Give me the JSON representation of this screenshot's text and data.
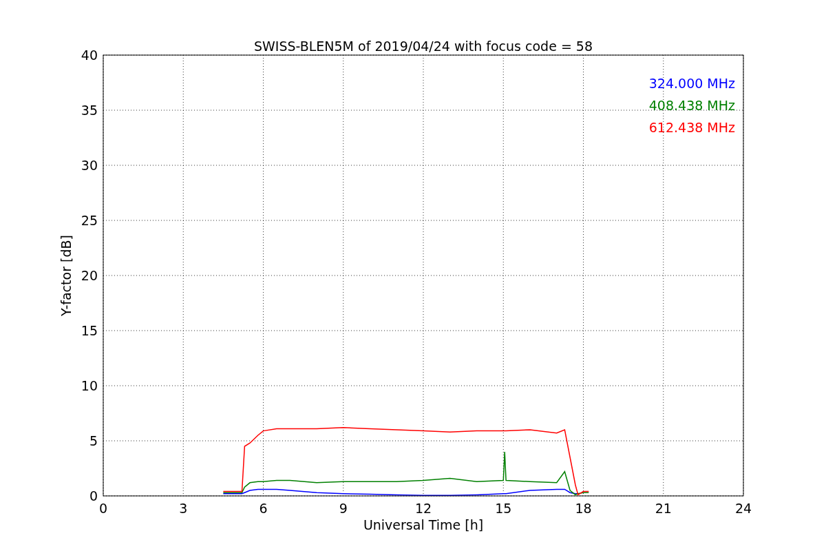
{
  "chart_data": {
    "type": "line",
    "title": "SWISS-BLEN5M of 2019/04/24 with focus code = 58",
    "xlabel": "Universal Time [h]",
    "ylabel": "Y-factor [dB]",
    "x": [
      4.5,
      5.2,
      5.3,
      5.5,
      5.8,
      6,
      6.5,
      7,
      8,
      9,
      10,
      11,
      12,
      13,
      14,
      15,
      15.05,
      15.1,
      16,
      17,
      17.3,
      17.5,
      17.7,
      17.8,
      18,
      18.2
    ],
    "series": [
      {
        "name": "324.000 MHz",
        "color": "#0000ff",
        "values": [
          0.2,
          0.2,
          0.3,
          0.5,
          0.6,
          0.6,
          0.6,
          0.5,
          0.3,
          0.2,
          0.15,
          0.1,
          0.05,
          0.05,
          0.1,
          0.2,
          0.2,
          0.2,
          0.5,
          0.6,
          0.6,
          0.3,
          0.2,
          0.2,
          null,
          null
        ]
      },
      {
        "name": "408.438 MHz",
        "color": "#008000",
        "values": [
          0.3,
          0.3,
          0.8,
          1.2,
          1.3,
          1.3,
          1.4,
          1.4,
          1.2,
          1.3,
          1.3,
          1.3,
          1.4,
          1.6,
          1.3,
          1.4,
          4.0,
          1.4,
          1.3,
          1.2,
          2.2,
          0.5,
          0.1,
          0.2,
          0.3,
          0.3
        ]
      },
      {
        "name": "612.438 MHz",
        "color": "#ff0000",
        "values": [
          0.4,
          0.4,
          4.5,
          4.8,
          5.5,
          5.9,
          6.1,
          6.1,
          6.1,
          6.2,
          6.1,
          6.0,
          5.9,
          5.8,
          5.9,
          5.9,
          5.9,
          5.9,
          6.0,
          5.7,
          6.0,
          3.5,
          1.0,
          0.1,
          0.4,
          0.4
        ]
      }
    ],
    "xlim": [
      0,
      24
    ],
    "ylim": [
      0,
      40
    ],
    "xticks": [
      0,
      3,
      6,
      9,
      12,
      15,
      18,
      21,
      24
    ],
    "yticks": [
      0,
      5,
      10,
      15,
      20,
      25,
      30,
      35,
      40
    ],
    "grid": true
  }
}
